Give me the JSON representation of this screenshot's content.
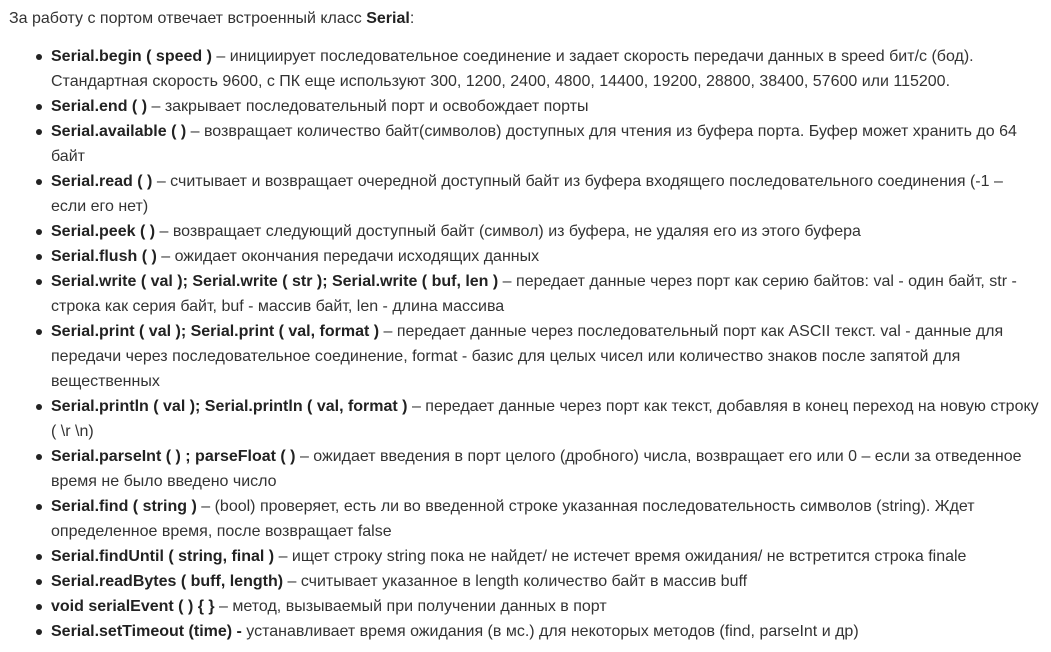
{
  "intro": {
    "text": "За работу с портом отвечает встроенный класс ",
    "class_name": "Serial",
    "end": ":"
  },
  "methods": [
    {
      "parts": [
        {
          "b": true,
          "t": "Serial.begin ( speed )"
        },
        {
          "b": false,
          "t": " – инициирует последовательное соединение и задает скорость передачи данных в speed бит/c (бод). Стандартная скорость 9600, с ПК еще используют  300, 1200, 2400, 4800, 14400, 19200, 28800, 38400, 57600 или 115200."
        }
      ]
    },
    {
      "parts": [
        {
          "b": true,
          "t": "Serial.end ( )"
        },
        {
          "b": false,
          "t": " – закрывает последовательный порт и освобождает порты"
        }
      ]
    },
    {
      "parts": [
        {
          "b": true,
          "t": "Serial.available ( )"
        },
        {
          "b": false,
          "t": " – возвращает количество байт(символов) доступных для чтения из буфера порта. Буфер может хранить до 64 байт"
        }
      ]
    },
    {
      "parts": [
        {
          "b": true,
          "t": "Serial.read ( )"
        },
        {
          "b": false,
          "t": " – считывает и возвращает очередной доступный байт из буфера входящего последовательного соединения (-1 – если его нет)"
        }
      ]
    },
    {
      "parts": [
        {
          "b": true,
          "t": "Serial.peek ( )"
        },
        {
          "b": false,
          "t": " – возвращает следующий доступный байт (символ) из буфера, не удаляя его из этого буфера"
        }
      ]
    },
    {
      "parts": [
        {
          "b": true,
          "t": "Serial.flush ( )"
        },
        {
          "b": false,
          "t": " – ожидает окончания передачи исходящих данных"
        }
      ]
    },
    {
      "parts": [
        {
          "b": true,
          "t": "Serial.write ( val ); Serial.write ( str ); Serial.write ( buf, len )"
        },
        {
          "b": false,
          "t": " – передает данные через порт как серию байтов: val - один байт, str - строка как серия байт, buf - массив байт, len - длина массива"
        }
      ]
    },
    {
      "parts": [
        {
          "b": true,
          "t": "Serial.print ( val ); Serial.print ( val, format )"
        },
        {
          "b": false,
          "t": " – передает данные через последовательный порт как ASCII текст. val - данные для передачи через последовательное соединение, format - базис для целых чисел или количество знаков после запятой для вещественных"
        }
      ]
    },
    {
      "parts": [
        {
          "b": true,
          "t": "Serial.println ( val ); Serial.println ( val, format )"
        },
        {
          "b": false,
          "t": " – передает данные через порт как текст, добавляя в конец переход на новую строку ( \\r \\n)"
        }
      ]
    },
    {
      "parts": [
        {
          "b": true,
          "t": "Serial.parseInt ( ) ; parseFloat ( )"
        },
        {
          "b": false,
          "t": " – ожидает введения в порт целого (дробного) числа, возвращает его или 0 – если за отведенное время не было введено число"
        }
      ]
    },
    {
      "parts": [
        {
          "b": true,
          "t": "Serial.find ( string )"
        },
        {
          "b": false,
          "t": " – (bool) проверяет, есть ли во введенной строке указанная последовательность символов (string). Ждет определенное время, после возвращает false"
        }
      ]
    },
    {
      "parts": [
        {
          "b": true,
          "t": "Serial.findUntil ( string, final )"
        },
        {
          "b": false,
          "t": " – ищет строку string пока не найдет/ не истечет время ожидания/ не встретится строка finale"
        }
      ]
    },
    {
      "parts": [
        {
          "b": true,
          "t": "Serial.readBytes ( buff, length)"
        },
        {
          "b": false,
          "t": " – считывает указанное в length количество байт в массив buff"
        }
      ]
    },
    {
      "parts": [
        {
          "b": true,
          "t": "void serialEvent ( ) { }"
        },
        {
          "b": false,
          "t": " – метод, вызываемый при получении данных в порт"
        }
      ]
    },
    {
      "parts": [
        {
          "b": true,
          "t": "Serial.setTimeout (time) -"
        },
        {
          "b": false,
          "t": " устанавливает время ожидания (в мс.) для некоторых методов (find, parseInt и др)"
        }
      ]
    }
  ]
}
